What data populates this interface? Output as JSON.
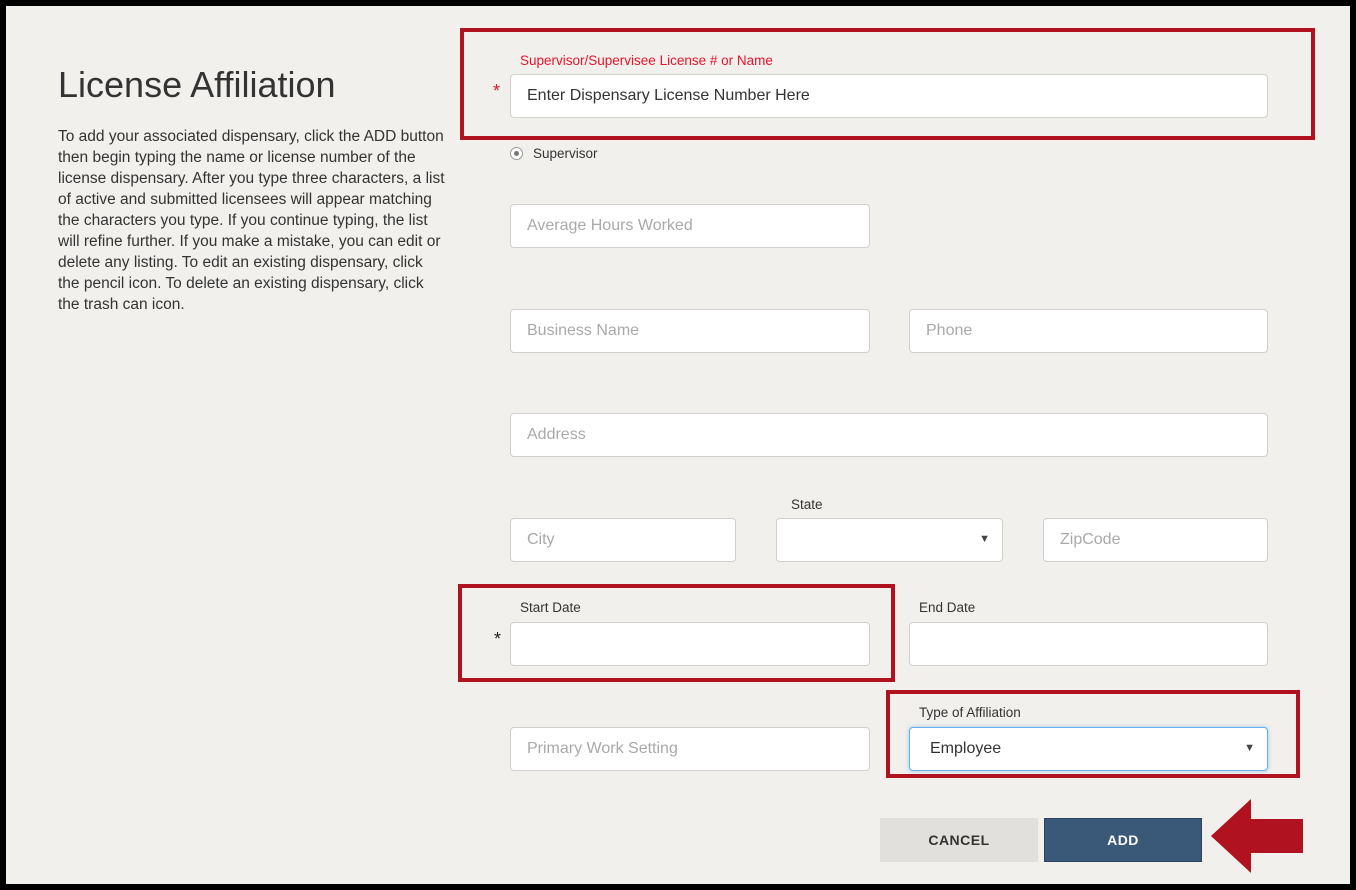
{
  "page": {
    "title": "License Affiliation",
    "help_text": "To add your associated dispensary, click the ADD button then begin typing the name or license number of the license dispensary. After you type three characters, a list of active and submitted licensees will appear matching the characters you type.  If you continue typing, the list will refine further.  If you make a mistake, you can edit or delete any listing. To edit an existing dispensary, click the pencil icon. To delete an existing dispensary, click the trash can icon."
  },
  "form": {
    "license": {
      "label": "Supervisor/Supervisee License # or Name",
      "required_mark": "*",
      "value": "Enter Dispensary License Number Here"
    },
    "role": {
      "label": "Supervisor",
      "selected": true
    },
    "average_hours": {
      "placeholder": "Average Hours Worked"
    },
    "business_name": {
      "placeholder": "Business Name"
    },
    "phone": {
      "placeholder": "Phone"
    },
    "address": {
      "placeholder": "Address"
    },
    "city": {
      "placeholder": "City"
    },
    "state": {
      "label": "State",
      "value": ""
    },
    "zipcode": {
      "placeholder": "ZipCode"
    },
    "start_date": {
      "label": "Start Date",
      "required_mark": "*",
      "value": ""
    },
    "end_date": {
      "label": "End Date",
      "value": ""
    },
    "primary_work_setting": {
      "placeholder": "Primary Work Setting"
    },
    "affiliation_type": {
      "label": "Type of Affiliation",
      "value": "Employee"
    }
  },
  "actions": {
    "cancel_label": "CANCEL",
    "add_label": "ADD"
  },
  "colors": {
    "highlight": "#b01220",
    "add_button": "#3a5978",
    "required": "#e8142b",
    "background": "#f1f0ec"
  },
  "icons": {
    "select_arrow": "chevron-down-icon",
    "pointer": "arrow-left-icon"
  }
}
